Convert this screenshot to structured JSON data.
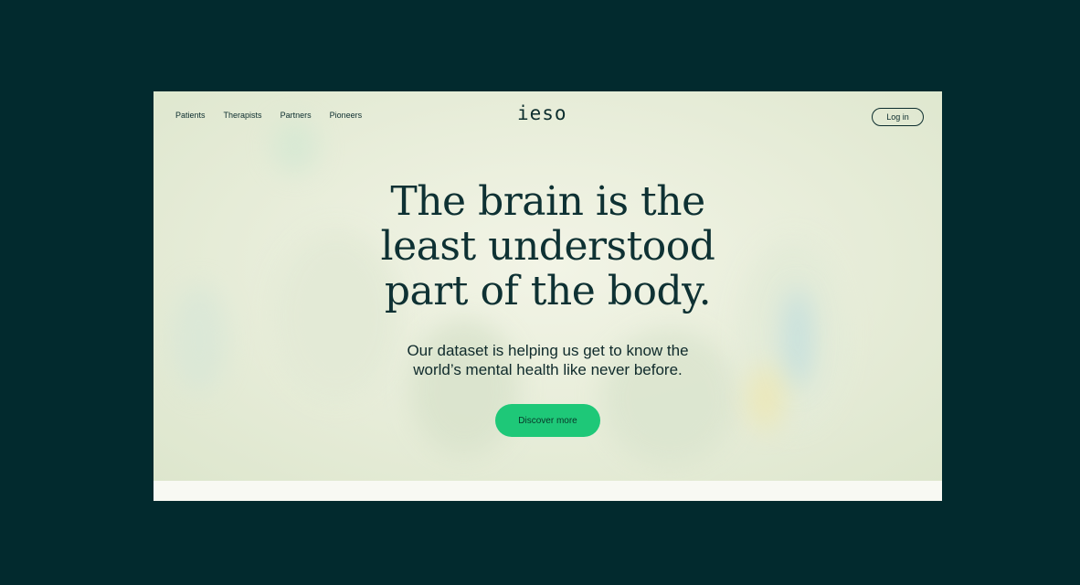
{
  "nav": {
    "links": [
      "Patients",
      "Therapists",
      "Partners",
      "Pioneers"
    ],
    "logo": "ieso",
    "login_label": "Log in"
  },
  "hero": {
    "headline_lines": [
      "The brain is the",
      "least understood",
      "part of the body."
    ],
    "subtext_lines": [
      "Our dataset is helping us get to know the",
      "world’s mental health like never before."
    ],
    "cta_label": "Discover more"
  },
  "colors": {
    "background": "#00272c",
    "cta": "#1ec878",
    "text": "#0e3133"
  }
}
